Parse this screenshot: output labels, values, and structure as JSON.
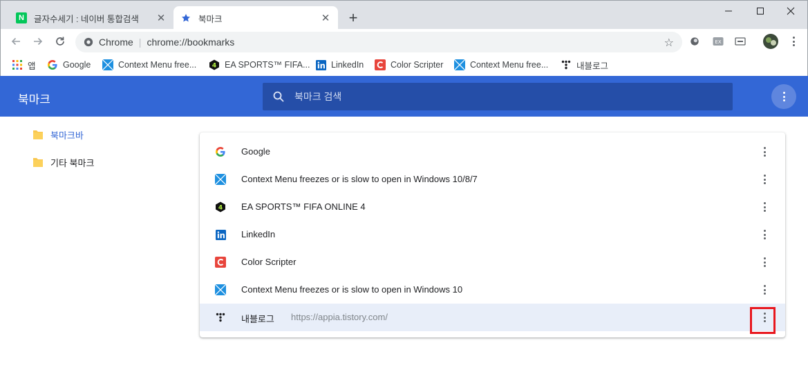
{
  "browser": {
    "tabs": [
      {
        "title": "글자수세기 : 네이버 통합검색",
        "favicon": "naver-n-icon",
        "active": false
      },
      {
        "title": "북마크",
        "favicon": "star-icon",
        "active": true
      }
    ],
    "newtab_label": "+",
    "omnibox": {
      "site_label": "Chrome",
      "url": "chrome://bookmarks"
    },
    "bookmarks_bar": [
      {
        "label": "앱",
        "icon": "apps-grid-icon"
      },
      {
        "label": "Google",
        "icon": "google-icon"
      },
      {
        "label": "Context Menu free...",
        "icon": "windows-icon"
      },
      {
        "label": "EA SPORTS™ FIFA...",
        "icon": "fifa-icon"
      },
      {
        "label": "LinkedIn",
        "icon": "linkedin-icon"
      },
      {
        "label": "Color Scripter",
        "icon": "color-scripter-icon"
      },
      {
        "label": "Context Menu free...",
        "icon": "windows-icon"
      },
      {
        "label": "내블로그",
        "icon": "tistory-icon"
      }
    ]
  },
  "app": {
    "title": "북마크",
    "search_placeholder": "북마크 검색"
  },
  "sidebar": {
    "folders": [
      {
        "label": "북마크바",
        "selected": true
      },
      {
        "label": "기타 북마크",
        "selected": false
      }
    ]
  },
  "list": {
    "items": [
      {
        "title": "Google",
        "url": "",
        "icon": "google-icon"
      },
      {
        "title": "Context Menu freezes or is slow to open in Windows 10/8/7",
        "url": "",
        "icon": "windows-icon"
      },
      {
        "title": "EA SPORTS™ FIFA ONLINE 4",
        "url": "",
        "icon": "fifa-icon"
      },
      {
        "title": "LinkedIn",
        "url": "",
        "icon": "linkedin-icon"
      },
      {
        "title": "Color Scripter",
        "url": "",
        "icon": "color-scripter-icon"
      },
      {
        "title": "Context Menu freezes or is slow to open in Windows 10",
        "url": "",
        "icon": "windows-icon"
      },
      {
        "title": "내블로그",
        "url": "https://appia.tistory.com/",
        "icon": "tistory-icon",
        "selected": true
      }
    ]
  },
  "colors": {
    "header_blue": "#3367d6",
    "search_bg": "#254ea8",
    "selected_row": "#e8eef9",
    "folder_yellow": "#fcd15b",
    "highlight_red": "#e8161d"
  }
}
